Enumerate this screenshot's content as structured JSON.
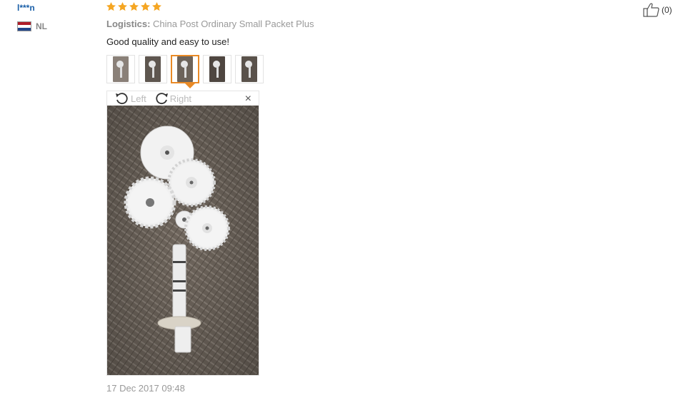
{
  "reviewer": {
    "name": "l***n",
    "country": "NL"
  },
  "rating": {
    "stars": 5,
    "max": 5
  },
  "logistics": {
    "label": "Logistics:",
    "value": "China Post Ordinary Small Packet Plus"
  },
  "comment": "Good quality and easy to use!",
  "thumbnails": {
    "count": 5,
    "active_index": 2
  },
  "viewer": {
    "rotate_left": "Left",
    "rotate_right": "Right",
    "close": "×"
  },
  "timestamp": "17 Dec 2017 09:48",
  "like": {
    "count": "(0)"
  },
  "colors": {
    "star": "#f5a623",
    "accent": "#e98a26",
    "username": "#1a5fa8"
  }
}
